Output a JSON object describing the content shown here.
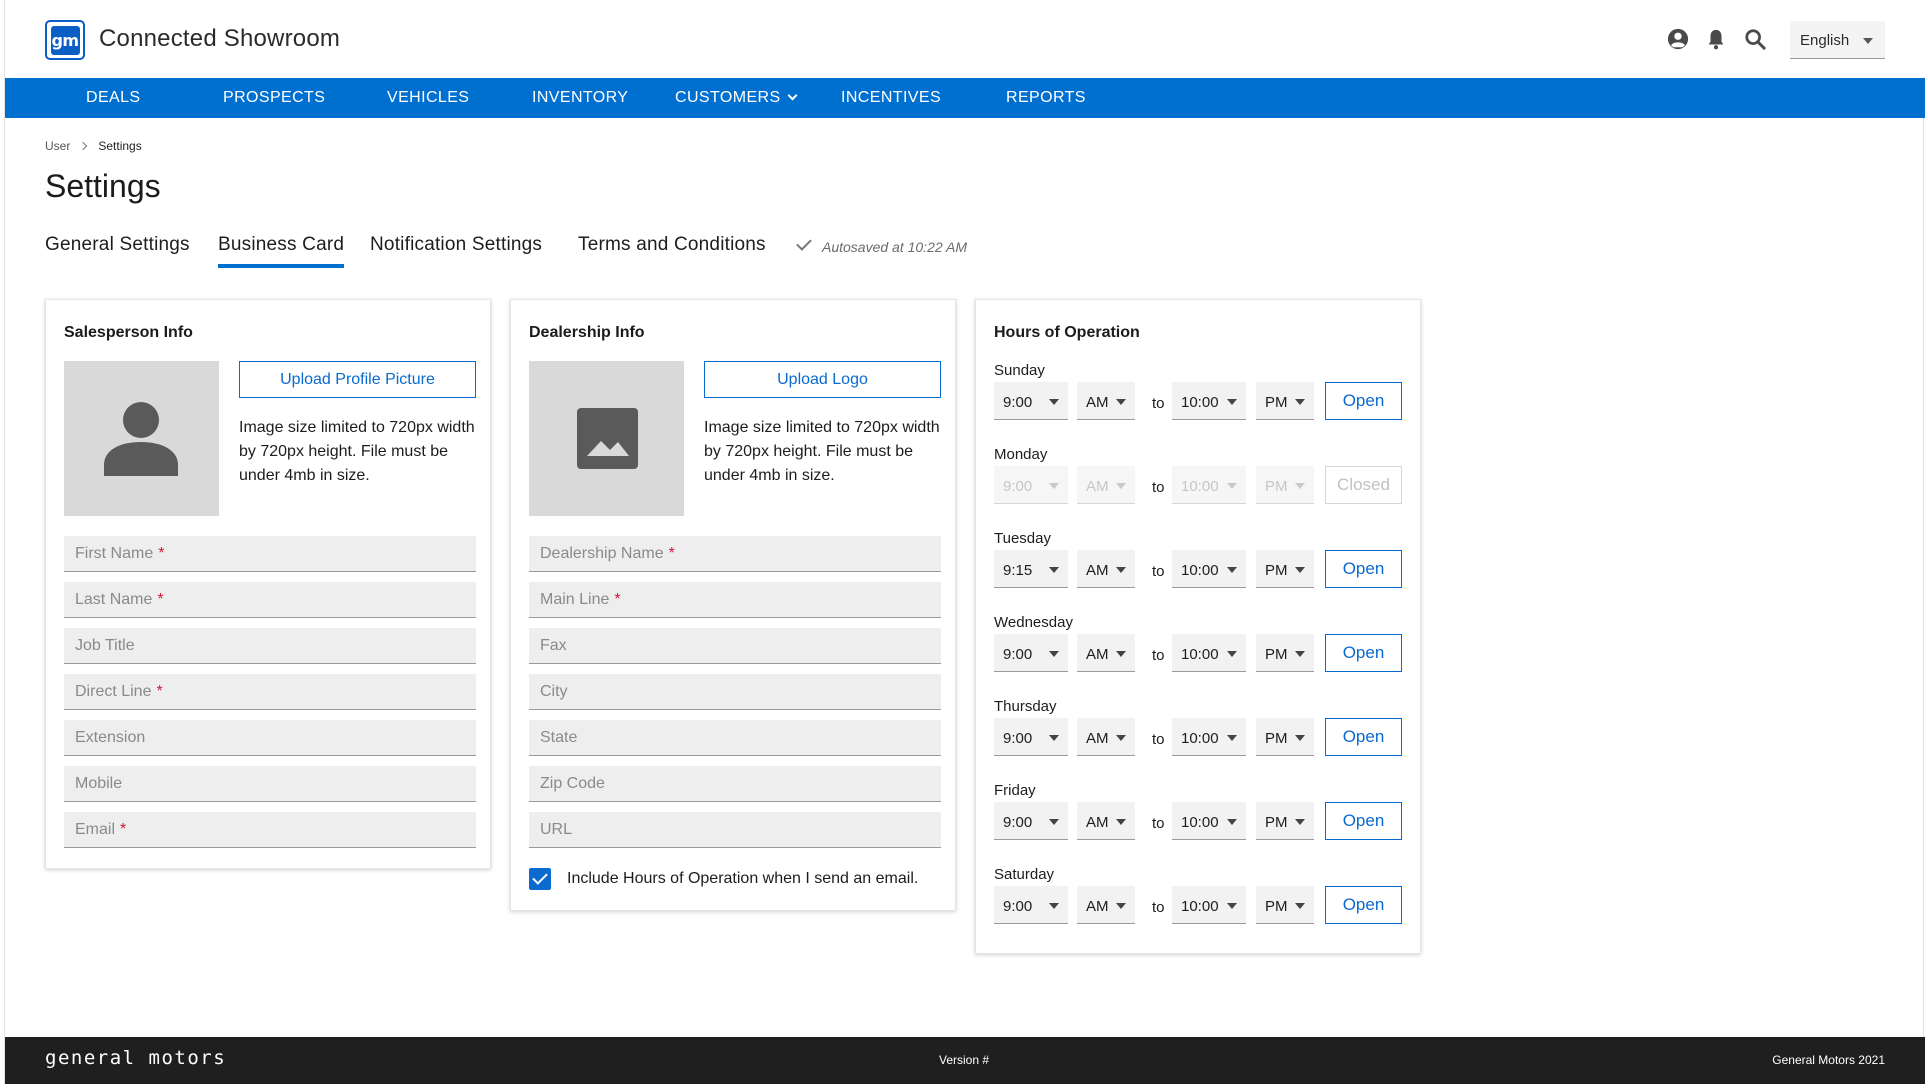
{
  "header": {
    "logo_text": "gm",
    "app_title": "Connected Showroom",
    "language": "English",
    "icons": [
      "account-icon",
      "bell-icon",
      "search-icon"
    ]
  },
  "nav": {
    "items": [
      "DEALS",
      "PROSPECTS",
      "VEHICLES",
      "INVENTORY",
      "CUSTOMERS",
      "INCENTIVES",
      "REPORTS"
    ]
  },
  "breadcrumb": {
    "parent": "User",
    "current": "Settings"
  },
  "page_title": "Settings",
  "tabs": {
    "items": [
      "General Settings",
      "Business Card",
      "Notification Settings",
      "Terms and Conditions"
    ],
    "active": "Business Card",
    "autosave": "Autosaved at 10:22 AM"
  },
  "salesperson": {
    "title": "Salesperson Info",
    "upload_label": "Upload Profile Picture",
    "help": "Image size limited to 720px width by 720px height. File must be under 4mb in size.",
    "fields": [
      {
        "label": "First Name",
        "required": "*"
      },
      {
        "label": "Last Name",
        "required": "*"
      },
      {
        "label": "Job Title",
        "required": ""
      },
      {
        "label": "Direct Line",
        "required": "*"
      },
      {
        "label": "Extension",
        "required": ""
      },
      {
        "label": "Mobile",
        "required": ""
      },
      {
        "label": "Email",
        "required": "*"
      }
    ]
  },
  "dealership": {
    "title": "Dealership Info",
    "upload_label": "Upload Logo",
    "help": "Image size limited to 720px width by 720px height. File must be under 4mb in size.",
    "fields": [
      {
        "label": "Dealership Name",
        "required": "*"
      },
      {
        "label": "Main Line",
        "required": "*"
      },
      {
        "label": "Fax",
        "required": ""
      },
      {
        "label": "City",
        "required": ""
      },
      {
        "label": "State",
        "required": ""
      },
      {
        "label": "Zip Code",
        "required": ""
      },
      {
        "label": "URL",
        "required": ""
      }
    ],
    "include_hours_label": "Include Hours of Operation when I send an email.",
    "include_hours_checked": true
  },
  "hours": {
    "title": "Hours of Operation",
    "to_label": "to",
    "days": [
      {
        "day": "Sunday",
        "open_time": "9:00",
        "open_ampm": "AM",
        "close_time": "10:00",
        "close_ampm": "PM",
        "status": "Open"
      },
      {
        "day": "Monday",
        "open_time": "9:00",
        "open_ampm": "AM",
        "close_time": "10:00",
        "close_ampm": "PM",
        "status": "Closed"
      },
      {
        "day": "Tuesday",
        "open_time": "9:15",
        "open_ampm": "AM",
        "close_time": "10:00",
        "close_ampm": "PM",
        "status": "Open"
      },
      {
        "day": "Wednesday",
        "open_time": "9:00",
        "open_ampm": "AM",
        "close_time": "10:00",
        "close_ampm": "PM",
        "status": "Open"
      },
      {
        "day": "Thursday",
        "open_time": "9:00",
        "open_ampm": "AM",
        "close_time": "10:00",
        "close_ampm": "PM",
        "status": "Open"
      },
      {
        "day": "Friday",
        "open_time": "9:00",
        "open_ampm": "AM",
        "close_time": "10:00",
        "close_ampm": "PM",
        "status": "Open"
      },
      {
        "day": "Saturday",
        "open_time": "9:00",
        "open_ampm": "AM",
        "close_time": "10:00",
        "close_ampm": "PM",
        "status": "Open"
      }
    ]
  },
  "footer": {
    "brand": "general motors",
    "version": "Version #",
    "copyright": "General Motors 2021"
  },
  "colors": {
    "primary": "#0070d0",
    "required": "#d4183b",
    "footer_bg": "#1f1f1f"
  }
}
